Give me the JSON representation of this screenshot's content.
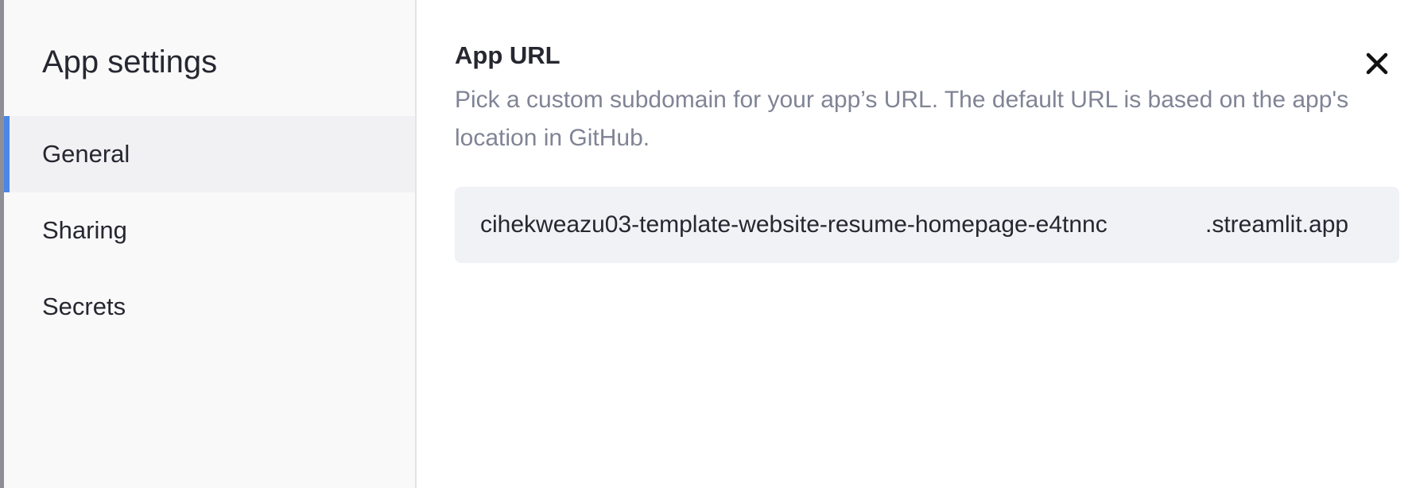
{
  "sidebar": {
    "title": "App settings",
    "items": [
      {
        "label": "General",
        "active": true
      },
      {
        "label": "Sharing",
        "active": false
      },
      {
        "label": "Secrets",
        "active": false
      }
    ]
  },
  "main": {
    "section_title": "App URL",
    "description": "Pick a custom subdomain for your app’s URL. The default URL is based on the app's location in GitHub.",
    "url_field": {
      "value": "cihekweazu03-template-website-resume-homepage-e4tnnc",
      "suffix": ".streamlit.app"
    }
  },
  "colors": {
    "accent": "#4a87e6",
    "text": "#262730",
    "muted_text": "#808495",
    "field_bg": "#f0f2f6",
    "sidebar_bg": "#f9f9fa",
    "overlay": "#8e8f96"
  },
  "icons": {
    "close": "close-icon"
  }
}
